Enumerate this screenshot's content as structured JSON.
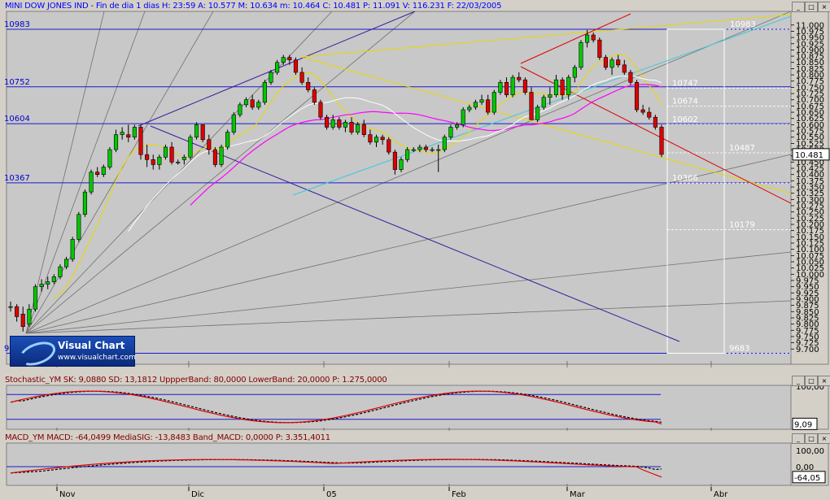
{
  "main": {
    "header": "MINI DOW JONES IND - Fin de dia 1 dias H: 23:59  A: 10.577  M: 10.634  m: 10.464  C: 10.481  P: 11.091  V: 116.231  F: 22/03/2005",
    "header_color": "#0000ff",
    "bg": "#c8c8c8",
    "level_labels": [
      "10983",
      "10752",
      "10604",
      "10367",
      "9683"
    ],
    "fib_labels": [
      "10983",
      "10747",
      "10674",
      "10602",
      "10487",
      "10366",
      "10179",
      "9683"
    ],
    "price_ticks": [
      "11.000",
      "10.975",
      "10.950",
      "10.925",
      "10.900",
      "10.875",
      "10.850",
      "10.825",
      "10.800",
      "10.775",
      "10.750",
      "10.725",
      "10.700",
      "10.675",
      "10.650",
      "10.625",
      "10.600",
      "10.575",
      "10.550",
      "10.525",
      "10.500",
      "10.475",
      "10.450",
      "10.425",
      "10.400",
      "10.375",
      "10.350",
      "10.325",
      "10.300",
      "10.275",
      "10.250",
      "10.225",
      "10.200",
      "10.175",
      "10.150",
      "10.125",
      "10.100",
      "10.075",
      "10.050",
      "10.025",
      "10.000",
      "9.975",
      "9.950",
      "9.925",
      "9.900",
      "9.875",
      "9.850",
      "9.825",
      "9.800",
      "9.775",
      "9.750",
      "9.725",
      "9.700"
    ],
    "last_price": "10.481"
  },
  "logo": {
    "name": "Visual Chart",
    "url": "www.visualchart.com"
  },
  "stoch": {
    "header": "Stochastic_YM  SK: 9,0880   SD: 13,1812   UppperBand: 80,0000   LowerBand: 20,0000   P: 1.275,0000",
    "header_color": "#800000",
    "ticks": [
      "100,00"
    ],
    "last": "9,09"
  },
  "macd": {
    "header": "MACD_YM  MACD: -64,0499   MediaSIG: -13,8483   Band_MACD: 0,0000   P: 3.351,4011",
    "header_color": "#800000",
    "ticks": [
      "100,00",
      "0,00"
    ],
    "last": "-64,05"
  },
  "months": [
    "Nov",
    "Dic",
    "05",
    "Feb",
    "Mar",
    "Abr"
  ],
  "chart_data": {
    "type": "candlestick",
    "instrument": "MINI DOW JONES IND",
    "ylim": [
      9700,
      11000
    ],
    "horizontal_levels": [
      10983,
      10752,
      10604,
      10367,
      9683
    ],
    "fibonacci_levels": [
      10983,
      10747,
      10674,
      10602,
      10487,
      10366,
      10179,
      9683
    ],
    "last_close": 10481,
    "candles": [
      [
        9870,
        9890,
        9850,
        9870
      ],
      [
        9870,
        9880,
        9810,
        9830
      ],
      [
        9840,
        9870,
        9770,
        9790
      ],
      [
        9800,
        9880,
        9790,
        9860
      ],
      [
        9860,
        9960,
        9850,
        9950
      ],
      [
        9950,
        9980,
        9930,
        9960
      ],
      [
        9960,
        9990,
        9940,
        9970
      ],
      [
        9970,
        10000,
        9960,
        9990
      ],
      [
        9990,
        10040,
        9980,
        10030
      ],
      [
        10030,
        10070,
        10020,
        10060
      ],
      [
        10060,
        10150,
        10050,
        10140
      ],
      [
        10140,
        10250,
        10130,
        10240
      ],
      [
        10240,
        10340,
        10230,
        10330
      ],
      [
        10330,
        10420,
        10320,
        10410
      ],
      [
        10410,
        10430,
        10390,
        10400
      ],
      [
        10400,
        10440,
        10390,
        10430
      ],
      [
        10430,
        10510,
        10420,
        10500
      ],
      [
        10500,
        10580,
        10490,
        10560
      ],
      [
        10560,
        10590,
        10540,
        10570
      ],
      [
        10560,
        10600,
        10530,
        10550
      ],
      [
        10550,
        10600,
        10540,
        10590
      ],
      [
        10590,
        10600,
        10460,
        10480
      ],
      [
        10480,
        10520,
        10430,
        10460
      ],
      [
        10460,
        10480,
        10420,
        10440
      ],
      [
        10440,
        10480,
        10420,
        10470
      ],
      [
        10470,
        10520,
        10460,
        10510
      ],
      [
        10510,
        10530,
        10440,
        10450
      ],
      [
        10450,
        10460,
        10440,
        10450
      ],
      [
        10460,
        10480,
        10440,
        10470
      ],
      [
        10470,
        10560,
        10460,
        10550
      ],
      [
        10550,
        10610,
        10540,
        10600
      ],
      [
        10600,
        10600,
        10530,
        10540
      ],
      [
        10540,
        10560,
        10480,
        10500
      ],
      [
        10500,
        10510,
        10430,
        10440
      ],
      [
        10440,
        10520,
        10430,
        10510
      ],
      [
        10510,
        10580,
        10500,
        10570
      ],
      [
        10570,
        10650,
        10560,
        10640
      ],
      [
        10640,
        10690,
        10630,
        10680
      ],
      [
        10680,
        10710,
        10670,
        10700
      ],
      [
        10700,
        10720,
        10660,
        10670
      ],
      [
        10670,
        10700,
        10660,
        10690
      ],
      [
        10690,
        10780,
        10680,
        10770
      ],
      [
        10770,
        10820,
        10760,
        10810
      ],
      [
        10810,
        10860,
        10800,
        10850
      ],
      [
        10850,
        10880,
        10840,
        10870
      ],
      [
        10870,
        10880,
        10840,
        10860
      ],
      [
        10860,
        10870,
        10800,
        10810
      ],
      [
        10810,
        10830,
        10760,
        10770
      ],
      [
        10770,
        10790,
        10730,
        10740
      ],
      [
        10740,
        10750,
        10680,
        10690
      ],
      [
        10690,
        10700,
        10620,
        10630
      ],
      [
        10630,
        10640,
        10580,
        10590
      ],
      [
        10590,
        10640,
        10580,
        10620
      ],
      [
        10620,
        10630,
        10580,
        10590
      ],
      [
        10590,
        10620,
        10570,
        10610
      ],
      [
        10610,
        10630,
        10560,
        10570
      ],
      [
        10570,
        10610,
        10560,
        10600
      ],
      [
        10600,
        10620,
        10550,
        10560
      ],
      [
        10560,
        10580,
        10520,
        10530
      ],
      [
        10530,
        10560,
        10510,
        10550
      ],
      [
        10550,
        10560,
        10520,
        10540
      ],
      [
        10540,
        10550,
        10480,
        10490
      ],
      [
        10490,
        10500,
        10400,
        10420
      ],
      [
        10420,
        10470,
        10410,
        10460
      ],
      [
        10460,
        10510,
        10450,
        10500
      ],
      [
        10500,
        10510,
        10490,
        10500
      ],
      [
        10500,
        10520,
        10490,
        10510
      ],
      [
        10510,
        10520,
        10490,
        10500
      ],
      [
        10500,
        10510,
        10490,
        10500
      ],
      [
        10500,
        10520,
        10410,
        10500
      ],
      [
        10500,
        10560,
        10490,
        10550
      ],
      [
        10550,
        10600,
        10540,
        10590
      ],
      [
        10590,
        10610,
        10580,
        10600
      ],
      [
        10600,
        10670,
        10590,
        10660
      ],
      [
        10660,
        10680,
        10650,
        10670
      ],
      [
        10670,
        10700,
        10660,
        10690
      ],
      [
        10690,
        10720,
        10680,
        10700
      ],
      [
        10700,
        10720,
        10640,
        10650
      ],
      [
        10650,
        10740,
        10640,
        10730
      ],
      [
        10730,
        10780,
        10720,
        10770
      ],
      [
        10770,
        10790,
        10710,
        10720
      ],
      [
        10720,
        10800,
        10710,
        10790
      ],
      [
        10790,
        10810,
        10770,
        10780
      ],
      [
        10780,
        10790,
        10720,
        10730
      ],
      [
        10730,
        10750,
        10620,
        10620
      ],
      [
        10620,
        10680,
        10610,
        10670
      ],
      [
        10670,
        10720,
        10660,
        10710
      ],
      [
        10710,
        10750,
        10680,
        10720
      ],
      [
        10720,
        10800,
        10710,
        10780
      ],
      [
        10780,
        10790,
        10700,
        10720
      ],
      [
        10720,
        10800,
        10700,
        10790
      ],
      [
        10790,
        10840,
        10770,
        10830
      ],
      [
        10830,
        10940,
        10820,
        10930
      ],
      [
        10930,
        10980,
        10910,
        10960
      ],
      [
        10960,
        10970,
        10930,
        10940
      ],
      [
        10940,
        10950,
        10860,
        10870
      ],
      [
        10870,
        10880,
        10820,
        10830
      ],
      [
        10830,
        10870,
        10800,
        10860
      ],
      [
        10860,
        10880,
        10830,
        10840
      ],
      [
        10840,
        10860,
        10800,
        10810
      ],
      [
        10810,
        10820,
        10760,
        10770
      ],
      [
        10770,
        10780,
        10650,
        10660
      ],
      [
        10660,
        10680,
        10640,
        10650
      ],
      [
        10650,
        10670,
        10620,
        10630
      ],
      [
        10630,
        10640,
        10580,
        10590
      ],
      [
        10590,
        10600,
        10470,
        10481
      ]
    ],
    "stochastic": {
      "SK": 9.088,
      "SD": 13.1812,
      "upper_band": 80,
      "lower_band": 20,
      "ylim": [
        0,
        100
      ]
    },
    "macd": {
      "MACD": -64.0499,
      "signal": -13.8483,
      "band": 0,
      "ylim": [
        -100,
        100
      ]
    },
    "x_labels": [
      "Nov",
      "Dic",
      "05",
      "Feb",
      "Mar",
      "Abr"
    ]
  }
}
